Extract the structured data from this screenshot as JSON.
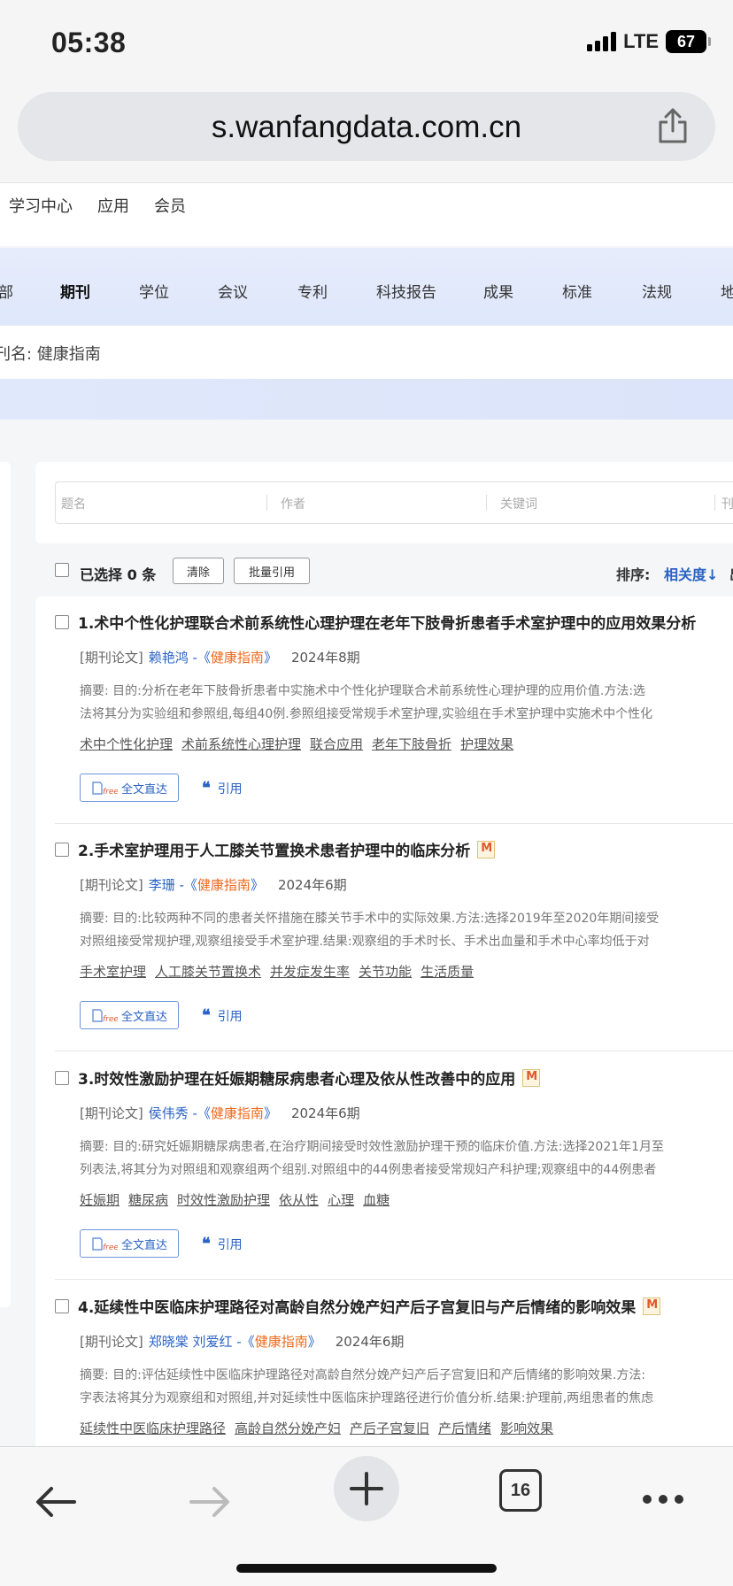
{
  "status": {
    "time": "05:38",
    "network": "LTE",
    "battery": "67"
  },
  "browser": {
    "url": "s.wanfangdata.com.cn",
    "tab_count": "16"
  },
  "site_nav": [
    "学习中心",
    "应用",
    "会员"
  ],
  "tabs": [
    "部",
    "期刊",
    "学位",
    "会议",
    "专利",
    "科技报告",
    "成果",
    "标准",
    "法规",
    "地"
  ],
  "active_tab": "期刊",
  "filter": {
    "label": "刊名: 健康指南"
  },
  "search_fields": [
    "题名",
    "作者",
    "关键词",
    "刊"
  ],
  "toolbar": {
    "selected_text": "已选择 0 条",
    "clear_label": "清除",
    "batch_cite_label": "批量引用",
    "sort_label": "排序:",
    "sort_value": "相关度↓",
    "sort_more": "出"
  },
  "result_actions": {
    "fulltext_label": "全文直达",
    "cite_label": "引用"
  },
  "results": [
    {
      "title": "1.术中个性化护理联合术前系统性心理护理在老年下肢骨折患者手术室护理中的应用效果分析",
      "type": "[期刊论文]",
      "authors": "赖艳鸿",
      "journal": "健康指南",
      "issue": "2024年8期",
      "abstract_1": "摘要: 目的:分析在老年下肢骨折患者中实施术中个性化护理联合术前系统性心理护理的应用价值.方法:选",
      "abstract_2": "法将其分为实验组和参照组,每组40例.参照组接受常规手术室护理,实验组在手术室护理中实施术中个性化",
      "keywords": [
        "术中个性化护理",
        "术前系统性心理护理",
        "联合应用",
        "老年下肢骨折",
        "护理效果"
      ]
    },
    {
      "title": "2.手术室护理用于人工膝关节置换术患者护理中的临床分析",
      "type": "[期刊论文]",
      "authors": "李珊",
      "journal": "健康指南",
      "issue": "2024年6期",
      "abstract_1": "摘要: 目的:比较两种不同的患者关怀措施在膝关节手术中的实际效果.方法:选择2019年至2020年期间接受",
      "abstract_2": "对照组接受常规护理,观察组接受手术室护理.结果:观察组的手术时长、手术出血量和手术中心率均低于对",
      "keywords": [
        "手术室护理",
        "人工膝关节置换术",
        "并发症发生率",
        "关节功能",
        "生活质量"
      ]
    },
    {
      "title": "3.时效性激励护理在妊娠期糖尿病患者心理及依从性改善中的应用",
      "type": "[期刊论文]",
      "authors": "侯伟秀",
      "journal": "健康指南",
      "issue": "2024年6期",
      "abstract_1": "摘要: 目的:研究妊娠期糖尿病患者,在治疗期间接受时效性激励护理干预的临床价值.方法:选择2021年1月至",
      "abstract_2": "列表法,将其分为对照组和观察组两个组别.对照组中的44例患者接受常规妇产科护理;观察组中的44例患者",
      "keywords": [
        "妊娠期",
        "糖尿病",
        "时效性激励护理",
        "依从性",
        "心理",
        "血糖"
      ]
    },
    {
      "title": "4.延续性中医临床护理路径对高龄自然分娩产妇产后子宫复旧与产后情绪的影响效果",
      "type": "[期刊论文]",
      "authors": "郑晓棠    刘爱红",
      "journal": "健康指南",
      "issue": "2024年6期",
      "abstract_1": "摘要: 目的:评估延续性中医临床护理路径对高龄自然分娩产妇产后子宫复旧和产后情绪的影响效果.方法:",
      "abstract_2": "字表法将其分为观察组和对照组,并对延续性中医临床护理路径进行价值分析.结果:护理前,两组患者的焦虑",
      "keywords": [
        "延续性中医临床护理路径",
        "高龄自然分娩产妇",
        "产后子宫复旧",
        "产后情绪",
        "影响效果"
      ]
    }
  ],
  "icons": {
    "share": "share-icon",
    "back": "back-arrow-icon",
    "forward": "forward-arrow-icon",
    "new_tab": "plus-icon",
    "tabs": "tabs-icon",
    "more": "more-icon",
    "free": "free-fulltext-icon",
    "quote": "quote-icon",
    "open_access": "m-badge-icon"
  },
  "colors": {
    "link_blue": "#2a63c5",
    "journal_orange": "#ee6a1e",
    "band_blue": "#e0e8fb"
  }
}
